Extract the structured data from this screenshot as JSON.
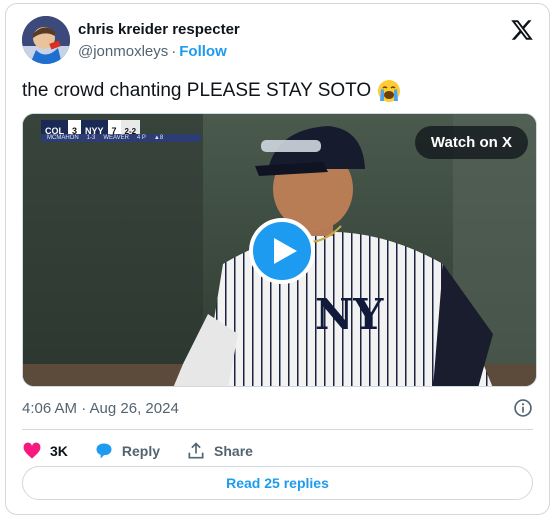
{
  "author": {
    "display_name": "chris kreider respecter",
    "handle": "@jonmoxleys",
    "separator": "·",
    "follow_label": "Follow"
  },
  "tweet": {
    "text": "the crowd chanting PLEASE STAY SOTO",
    "emoji_icon": "loudly-crying-face-icon",
    "timestamp": "4:06 AM · Aug 26, 2024"
  },
  "video": {
    "watch_label": "Watch on X",
    "scorebug": {
      "away_team": "COL",
      "away_score": "3",
      "home_team": "NYY",
      "home_score": "7",
      "count": "2-2",
      "outs_label": "▲8",
      "pitcher_line": "MCMAHON",
      "pitcher_stat": "1-3",
      "batter_line": "WEAVER",
      "batter_stat": "4 P"
    }
  },
  "actions": {
    "likes_count": "3K",
    "reply_label": "Reply",
    "share_label": "Share"
  },
  "read_replies_label": "Read 25 replies",
  "colors": {
    "accent": "#1d9bf0",
    "like": "#f91880",
    "text_secondary": "#536471",
    "border": "#cfd9de"
  }
}
